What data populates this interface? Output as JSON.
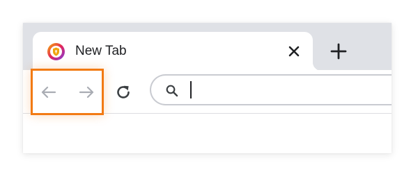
{
  "tab": {
    "title": "New Tab",
    "favicon": "lock-shield-icon",
    "close_icon": "close-icon"
  },
  "tabstrip": {
    "new_tab_icon": "plus-icon"
  },
  "toolbar": {
    "back_icon": "arrow-left-icon",
    "forward_icon": "arrow-right-icon",
    "reload_icon": "reload-icon",
    "back_enabled": false,
    "forward_enabled": false
  },
  "omnibox": {
    "value": "",
    "placeholder": "",
    "search_icon": "search-icon"
  },
  "colors": {
    "tabstrip_bg": "#dfe1e6",
    "highlight": "#f27a13",
    "icon_disabled": "#a9acb3",
    "icon_active": "#3c4043",
    "favicon_ring": [
      "#f7b500",
      "#e3245c",
      "#7b3fe4"
    ]
  }
}
